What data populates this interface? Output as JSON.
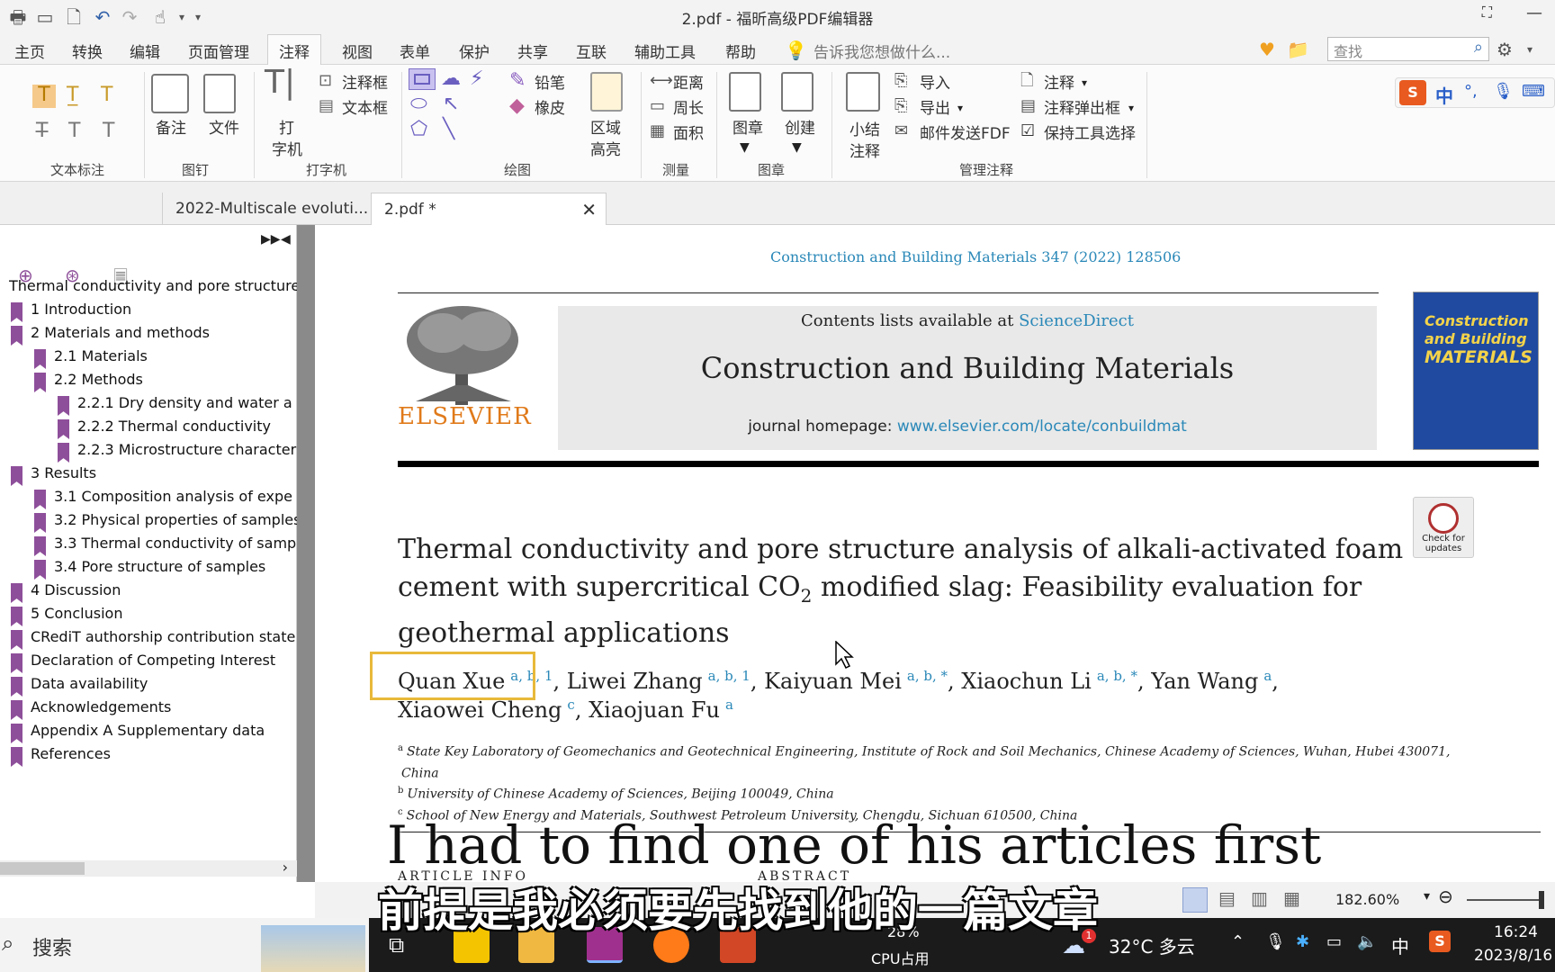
{
  "window": {
    "title": "2.pdf - 福昕高级PDF编辑器"
  },
  "menu": {
    "tabs": [
      "主页",
      "转换",
      "编辑",
      "页面管理",
      "注释",
      "视图",
      "表单",
      "保护",
      "共享",
      "互联",
      "辅助工具",
      "帮助"
    ],
    "active_tab": "注释",
    "tell_me": "告诉我您想做什么...",
    "search_placeholder": "查找"
  },
  "ribbon": {
    "groups": {
      "text_markup": "文本标注",
      "pin": "图钉",
      "typewriter": "打字机",
      "drawing": "绘图",
      "measure": "测量",
      "stamp": "图章",
      "manage": "管理注释"
    },
    "pin": {
      "note": "备注",
      "file": "文件"
    },
    "typewriter": {
      "type": "打",
      "type2": "字机",
      "callout": "注释框",
      "textbox": "文本框"
    },
    "drawing": {
      "pencil": "铅笔",
      "eraser": "橡皮",
      "area": "区域",
      "area2": "高亮"
    },
    "measure": {
      "distance": "距离",
      "perimeter": "周长",
      "area": "面积"
    },
    "stamp": {
      "stamp": "图章",
      "create": "创建"
    },
    "manage": {
      "summary": "小结",
      "summary2": "注释",
      "import": "导入",
      "export": "导出",
      "email": "邮件发送FDF",
      "comment": "注释",
      "popup": "注释弹出框",
      "keep_tool": "保持工具选择"
    }
  },
  "doc_tabs": [
    "2022-Multiscale evoluti...",
    "2.pdf *"
  ],
  "bookmarks": [
    {
      "label": "Thermal conductivity and pore structure",
      "level": 0
    },
    {
      "label": "1 Introduction",
      "level": 1
    },
    {
      "label": "2 Materials and methods",
      "level": 1
    },
    {
      "label": "2.1 Materials",
      "level": 2
    },
    {
      "label": "2.2 Methods",
      "level": 2
    },
    {
      "label": "2.2.1 Dry density and water a",
      "level": 3
    },
    {
      "label": "2.2.2 Thermal conductivity",
      "level": 3
    },
    {
      "label": "2.2.3 Microstructure character",
      "level": 3
    },
    {
      "label": "3 Results",
      "level": 1
    },
    {
      "label": "3.1 Composition analysis of expe",
      "level": 2
    },
    {
      "label": "3.2 Physical properties of samples",
      "level": 2
    },
    {
      "label": "3.3 Thermal conductivity of samp",
      "level": 2
    },
    {
      "label": "3.4 Pore structure of samples",
      "level": 2
    },
    {
      "label": "4 Discussion",
      "level": 1
    },
    {
      "label": "5 Conclusion",
      "level": 1
    },
    {
      "label": "CRediT authorship contribution state",
      "level": 1
    },
    {
      "label": "Declaration of Competing Interest",
      "level": 1
    },
    {
      "label": "Data availability",
      "level": 1
    },
    {
      "label": "Acknowledgements",
      "level": 1
    },
    {
      "label": "Appendix A Supplementary data",
      "level": 1
    },
    {
      "label": "References",
      "level": 1
    }
  ],
  "paper": {
    "citation": "Construction and Building Materials 347 (2022) 128506",
    "contents_prefix": "Contents lists available at ",
    "sciencedirect": "ScienceDirect",
    "journal": "Construction and Building Materials",
    "homepage_prefix": "journal homepage: ",
    "homepage_url": "www.elsevier.com/locate/conbuildmat",
    "publisher": "ELSEVIER",
    "cover": {
      "line1": "Construction",
      "line2": "and Building",
      "line3": "MATERIALS"
    },
    "check_updates": "Check for updates",
    "title_line1": "Thermal conductivity and pore structure analysis of alkali-activated foam",
    "title_line2a": "cement with supercritical CO",
    "title_sub": "2",
    "title_line2b": " modified slag: Feasibility evaluation for",
    "title_line3": "geothermal applications",
    "authors_line1": [
      {
        "name": "Quan Xue",
        "sup": "a, b, 1"
      },
      {
        "name": "Liwei Zhang",
        "sup": "a, b, 1"
      },
      {
        "name": "Kaiyuan Mei",
        "sup": "a, b, *"
      },
      {
        "name": "Xiaochun Li",
        "sup": "a, b, *"
      },
      {
        "name": "Yan Wang",
        "sup": "a"
      }
    ],
    "authors_line2": [
      {
        "name": "Xiaowei Cheng",
        "sup": "c"
      },
      {
        "name": "Xiaojuan Fu",
        "sup": "a"
      }
    ],
    "affiliations": [
      {
        "sup": "a",
        "text": "State Key Laboratory of Geomechanics and Geotechnical Engineering, Institute of Rock and Soil Mechanics, Chinese Academy of Sciences, Wuhan, Hubei 430071,"
      },
      {
        "sup": "",
        "text": "China"
      },
      {
        "sup": "b",
        "text": "University of Chinese Academy of Sciences, Beijing 100049, China"
      },
      {
        "sup": "c",
        "text": "School of New Energy and Materials, Southwest Petroleum University, Chengdu, Sichuan 610500, China"
      }
    ],
    "article_info": "ARTICLE INFO",
    "abstract": "ABSTRACT"
  },
  "status": {
    "zoom": "182.60%"
  },
  "subtitles": {
    "en": "I had to find one of his articles first",
    "cn": "前提是我必须要先找到他的一篇文章"
  },
  "taskbar": {
    "search": "搜索",
    "cpu_percent": "28%",
    "cpu_label": "CPU占用",
    "weather": "32°C  多云",
    "weather_badge": "1",
    "ime": "中",
    "time": "16:24",
    "date": "2023/8/16"
  },
  "colors": {
    "accent_link": "#2a88b8",
    "bookmark": "#8e4f9a",
    "highlight_box": "#e8b93a"
  }
}
